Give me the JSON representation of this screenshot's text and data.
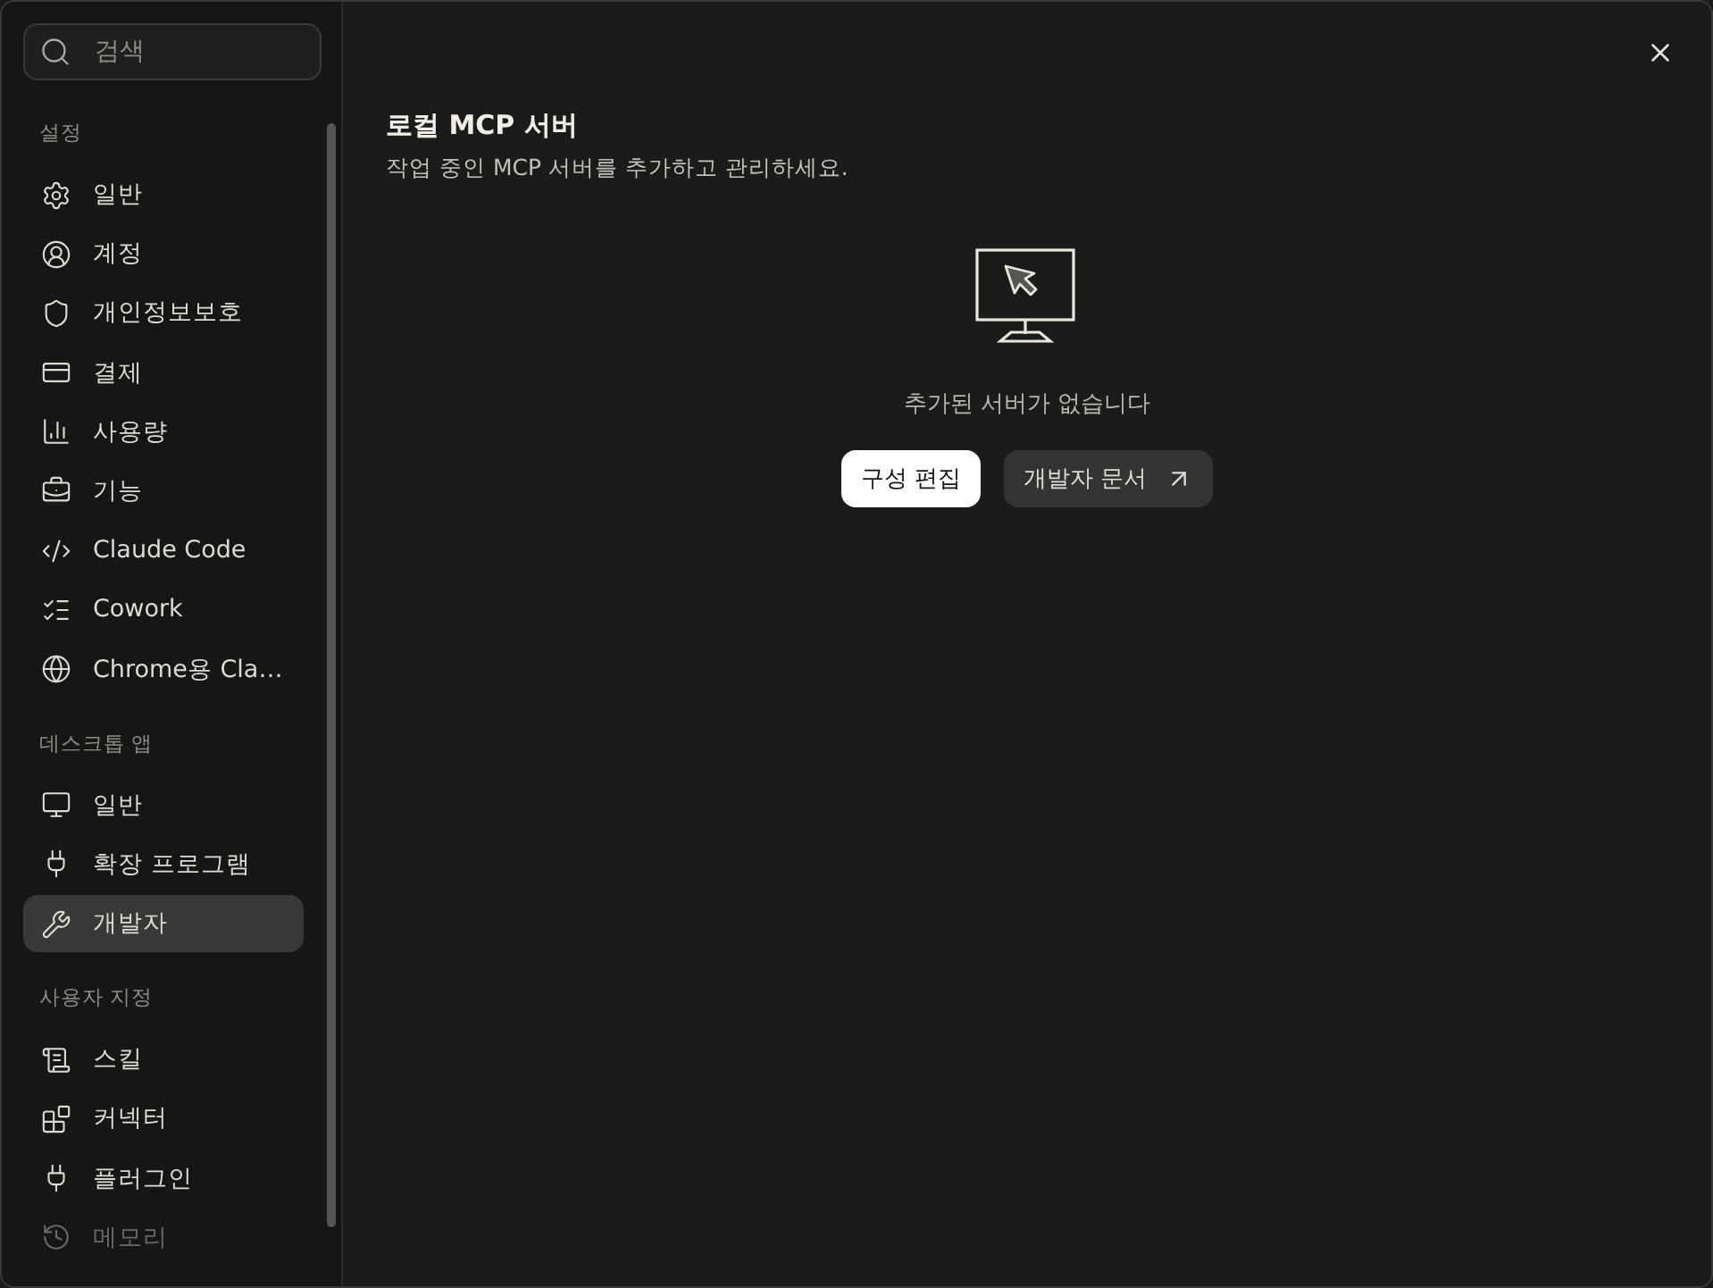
{
  "search": {
    "placeholder": "검색"
  },
  "sections": [
    {
      "label": "설정",
      "items": [
        {
          "label": "일반",
          "selected": false
        },
        {
          "label": "계정",
          "selected": false
        },
        {
          "label": "개인정보보호",
          "selected": false
        },
        {
          "label": "결제",
          "selected": false
        },
        {
          "label": "사용량",
          "selected": false
        },
        {
          "label": "기능",
          "selected": false
        },
        {
          "label": "Claude Code",
          "selected": false
        },
        {
          "label": "Cowork",
          "selected": false
        },
        {
          "label": "Chrome용 Cla…",
          "selected": false
        }
      ]
    },
    {
      "label": "데스크톱 앱",
      "items": [
        {
          "label": "일반",
          "selected": false
        },
        {
          "label": "확장 프로그램",
          "selected": false
        },
        {
          "label": "개발자",
          "selected": true
        }
      ]
    },
    {
      "label": "사용자 지정",
      "items": [
        {
          "label": "스킬",
          "selected": false
        },
        {
          "label": "커넥터",
          "selected": false
        },
        {
          "label": "플러그인",
          "selected": false
        },
        {
          "label": "메모리",
          "selected": false
        }
      ]
    }
  ],
  "main": {
    "title": "로컬 MCP 서버",
    "description": "작업 중인 MCP 서버를 추가하고 관리하세요.",
    "empty_message": "추가된 서버가 없습니다",
    "buttons": [
      {
        "label": "구성 편집",
        "kind": "primary"
      },
      {
        "label": "개발자 문서",
        "kind": "external"
      }
    ]
  }
}
